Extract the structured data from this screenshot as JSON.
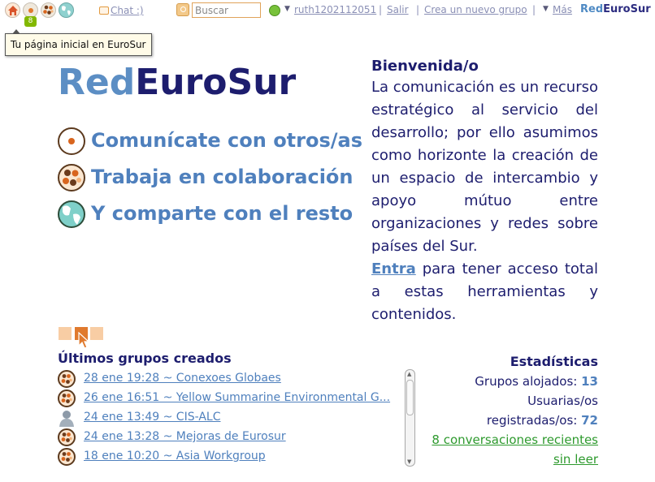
{
  "topbar": {
    "badge_count": "8",
    "chat_label": "Chat :)",
    "search_placeholder": "Buscar",
    "username": "ruth1202112051",
    "logout": "Salir",
    "create_group": "Crea un nuevo grupo",
    "more": "Más",
    "separator": "|",
    "brand": {
      "part1": "Red",
      "part2": "EuroSur"
    }
  },
  "tooltip": "Tu página inicial en EuroSur",
  "hero": {
    "brand": {
      "part1": "Red",
      "part2": "EuroSur"
    },
    "features": [
      {
        "label": "Comunícate con otros/as",
        "icon": "communicate-icon"
      },
      {
        "label": "Trabaja en colaboración",
        "icon": "collaborate-icon"
      },
      {
        "label": "Y comparte con el resto",
        "icon": "world-icon"
      }
    ]
  },
  "welcome": {
    "heading": "Bienvenida/o",
    "body": "La comunicación es un recurso estratégico al servicio del desarrollo; por ello asumimos como horizonte la creación de un espacio de intercambio y apoyo mútuo entre organizaciones y redes sobre países del Sur.",
    "enter_link": "Entra",
    "enter_rest": " para tener acceso total a estas herramientas y contenidos."
  },
  "carousel": {
    "slides": 3,
    "active_index": 1
  },
  "groups": {
    "title": "Últimos grupos creados",
    "items": [
      {
        "text": "28 ene 19:28 ~ Conexoes Globaes",
        "icon": "collaborate-icon"
      },
      {
        "text": "26 ene 16:51 ~ Yellow Summarine Environmental G...",
        "icon": "collaborate-icon"
      },
      {
        "text": "24 ene 13:49 ~ CIS-ALC",
        "icon": "user-silhouette-icon"
      },
      {
        "text": "24 ene 13:28 ~ Mejoras de Eurosur",
        "icon": "collaborate-icon"
      },
      {
        "text": "18 ene 10:20 ~ Asia Workgroup",
        "icon": "collaborate-icon"
      }
    ]
  },
  "stats": {
    "title": "Estadísticas",
    "hosted_label": "Grupos alojados:",
    "hosted_value": "13",
    "users_label_1": "Usuarias/os",
    "users_label_2": "registradas/os:",
    "users_value": "72",
    "recent_line_1": "8 conversaciones recientes",
    "recent_line_2": "sin leer"
  },
  "colors": {
    "brand_light": "#5c8ec4",
    "brand_dark": "#1d1d6e",
    "accent": "#e07a2e",
    "link_green": "#2e9a2e",
    "badge": "#82b800"
  }
}
